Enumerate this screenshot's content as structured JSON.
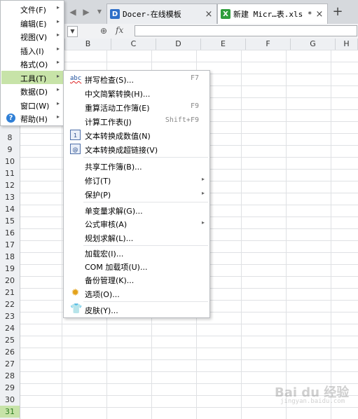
{
  "tabs": [
    {
      "title": "Docer-在线模板",
      "close": "×",
      "icon": "docer-icon"
    },
    {
      "title": "新建 Micr…表.xls *",
      "close": "×",
      "icon": "xls-icon"
    }
  ],
  "tab_new": "+",
  "nav": {
    "back": "◀",
    "forward": "▶",
    "dropdown": "▼"
  },
  "formula": {
    "fx": "fx",
    "value": ""
  },
  "columns": [
    "B",
    "C",
    "D",
    "E",
    "F",
    "G",
    "H"
  ],
  "rows": [
    "8",
    "9",
    "10",
    "11",
    "12",
    "13",
    "14",
    "15",
    "16",
    "17",
    "18",
    "19",
    "20",
    "21",
    "22",
    "23",
    "24",
    "25",
    "26",
    "27",
    "28",
    "29",
    "30",
    "31"
  ],
  "selected_row": "31",
  "main_menu": [
    {
      "label": "文件(F)",
      "arrow": "▸"
    },
    {
      "label": "编辑(E)",
      "arrow": "▸"
    },
    {
      "label": "视图(V)",
      "arrow": "▸"
    },
    {
      "label": "插入(I)",
      "arrow": "▸"
    },
    {
      "label": "格式(O)",
      "arrow": "▸"
    },
    {
      "label": "工具(T)",
      "arrow": "▸",
      "active": true
    },
    {
      "label": "数据(D)",
      "arrow": "▸"
    },
    {
      "label": "窗口(W)",
      "arrow": "▸"
    },
    {
      "label": "帮助(H)",
      "arrow": "▸",
      "icon": "?"
    }
  ],
  "tools_menu": {
    "spell_check": {
      "label": "拼写检查(S)...",
      "shortcut": "F7",
      "icon": "abc"
    },
    "chinese_convert": {
      "label": "中文简繁转换(H)..."
    },
    "recalc_workbook": {
      "label": "重算活动工作簿(E)",
      "shortcut": "F9"
    },
    "calc_sheet": {
      "label": "计算工作表(J)",
      "shortcut": "Shift+F9"
    },
    "text_to_number": {
      "label": "文本转换成数值(N)",
      "icon": "1"
    },
    "text_to_hyperlink": {
      "label": "文本转换成超链接(V)",
      "icon": "@"
    },
    "share_workbook": {
      "label": "共享工作簿(B)..."
    },
    "track_changes": {
      "label": "修订(T)",
      "arrow": "▸"
    },
    "protection": {
      "label": "保护(P)",
      "arrow": "▸"
    },
    "goal_seek": {
      "label": "单变量求解(G)..."
    },
    "formula_audit": {
      "label": "公式审核(A)",
      "arrow": "▸"
    },
    "solver": {
      "label": "规划求解(L)..."
    },
    "addins": {
      "label": "加载宏(I)..."
    },
    "com_addins": {
      "label": "COM 加载项(U)..."
    },
    "backup": {
      "label": "备份管理(K)..."
    },
    "options": {
      "label": "选项(O)...",
      "icon": "✹"
    },
    "skin": {
      "label": "皮肤(Y)...",
      "icon": "👕"
    }
  },
  "colors": {
    "accent_green": "#c7e3a8",
    "tab_bar": "#d6d9dd"
  },
  "watermark": {
    "text": "Bai du 经验",
    "sub": "jingyan.baidu.com"
  }
}
